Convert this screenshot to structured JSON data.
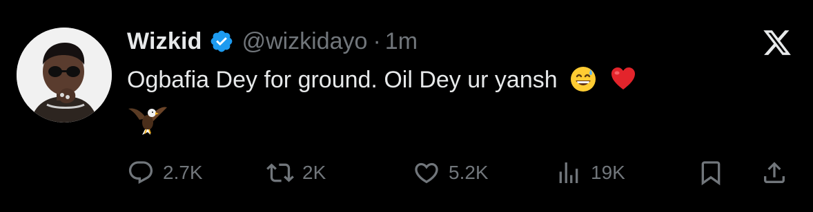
{
  "tweet": {
    "display_name": "Wizkid",
    "handle": "@wizkidayo",
    "separator": "·",
    "time": "1m",
    "text": "Ogbafia Dey for ground. Oil Dey ur yansh",
    "emojis": [
      "grinning-sweat-emoji",
      "red-heart-emoji",
      "eagle-emoji"
    ],
    "verified": true
  },
  "actions": {
    "replies": "2.7K",
    "reposts": "2K",
    "likes": "5.2K",
    "views": "19K"
  },
  "colors": {
    "background": "#000000",
    "text": "#e7e9ea",
    "muted": "#71767b",
    "verified_blue": "#1d9bf0"
  },
  "icons": {
    "brand": "x-logo-icon",
    "reply": "comment-icon",
    "repost": "repost-icon",
    "like": "heart-icon",
    "views": "views-bar-icon",
    "bookmark": "bookmark-icon",
    "share": "share-icon"
  }
}
